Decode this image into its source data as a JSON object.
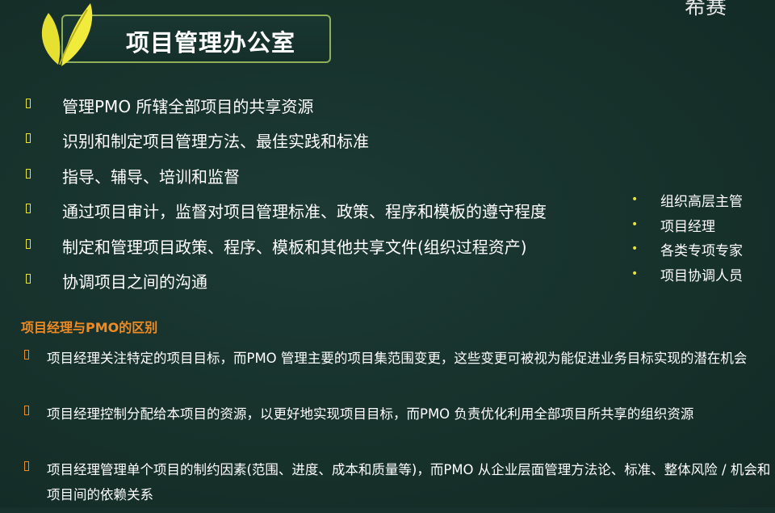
{
  "title": "项目管理办公室",
  "watermark": "希赛",
  "pmo_functions": [
    "管理PMO 所辖全部项目的共享资源",
    "识别和制定项目管理方法、最佳实践和标准",
    "指导、辅导、培训和监督",
    "通过项目审计，监督对项目管理标准、政策、程序和模板的遵守程度",
    "制定和管理项目政策、程序、模板和其他共享文件(组织过程资产)",
    "协调项目之间的沟通"
  ],
  "roles": [
    "组织高层主管",
    "项目经理",
    "各类专项专家",
    "项目协调人员"
  ],
  "difference_heading": "项目经理与PMO的区别",
  "differences": [
    "项目经理关注特定的项目目标，而PMO 管理主要的项目集范围变更，这些变更可被视为能促进业务目标实现的潜在机会",
    " 项目经理控制分配给本项目的资源，以更好地实现项目目标，而PMO 负责优化利用全部项目所共享的组织资源",
    " 项目经理管理单个项目的制约因素(范围、进度、成本和质量等)，而PMO 从企业层面管理方法论、标准、整体风险 / 机会和项目间的依赖关系"
  ],
  "colors": {
    "accent_yellow": "#e8e43a",
    "accent_orange": "#f08a22",
    "frame_green": "#8fae5a",
    "background": "#17302b"
  }
}
